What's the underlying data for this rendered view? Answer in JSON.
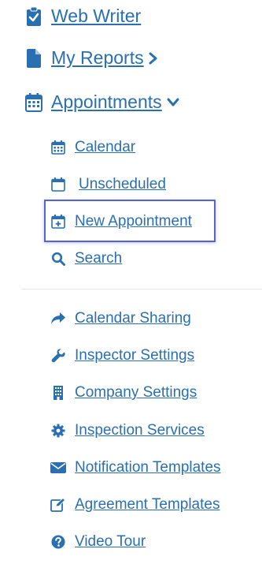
{
  "main_nav": [
    {
      "label": "Web Writer",
      "icon": "clipboard-check-icon"
    },
    {
      "label": "My Reports",
      "icon": "document-icon"
    },
    {
      "label": "Appointments",
      "icon": "calendar-icon"
    }
  ],
  "appointments_submenu": [
    {
      "label": "Calendar",
      "icon": "calendar-icon"
    },
    {
      "label": "Unscheduled",
      "icon": "calendar-empty-icon"
    },
    {
      "label": "New Appointment",
      "icon": "calendar-plus-icon",
      "highlighted": true
    },
    {
      "label": "Search",
      "icon": "search-icon"
    }
  ],
  "settings_nav": [
    {
      "label": "Calendar Sharing",
      "icon": "share-icon"
    },
    {
      "label": "Inspector Settings",
      "icon": "wrench-icon"
    },
    {
      "label": "Company Settings",
      "icon": "building-icon"
    },
    {
      "label": "Inspection Services",
      "icon": "gear-icon"
    },
    {
      "label": "Notification Templates",
      "icon": "envelope-icon"
    },
    {
      "label": "Agreement Templates",
      "icon": "edit-icon"
    },
    {
      "label": "Video Tour",
      "icon": "question-circle-icon"
    }
  ],
  "colors": {
    "link": "#2a6fb0",
    "highlight_border": "#5563d9"
  }
}
